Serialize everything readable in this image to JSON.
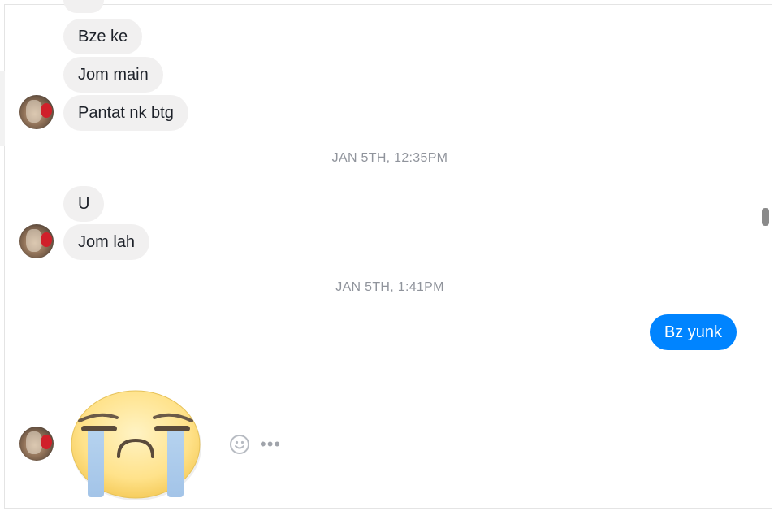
{
  "conversation": {
    "messages_top": [
      {
        "text": "Bze ke"
      },
      {
        "text": "Jom main"
      },
      {
        "text": "Pantat nk btg"
      }
    ],
    "timestamp_1": "JAN 5TH, 12:35PM",
    "messages_mid": [
      {
        "text": "U"
      },
      {
        "text": "Jom lah"
      }
    ],
    "timestamp_2": "JAN 5TH, 1:41PM",
    "outgoing": {
      "text": "Bz yunk"
    },
    "sticker": {
      "icon": "crying-face-sticker-icon"
    }
  },
  "actions": {
    "reaction_icon": "smiley-icon",
    "more_label": "•••"
  },
  "colors": {
    "incoming_bubble": "#f1f0f0",
    "outgoing_bubble": "#0084ff",
    "timestamp": "#90949c"
  }
}
